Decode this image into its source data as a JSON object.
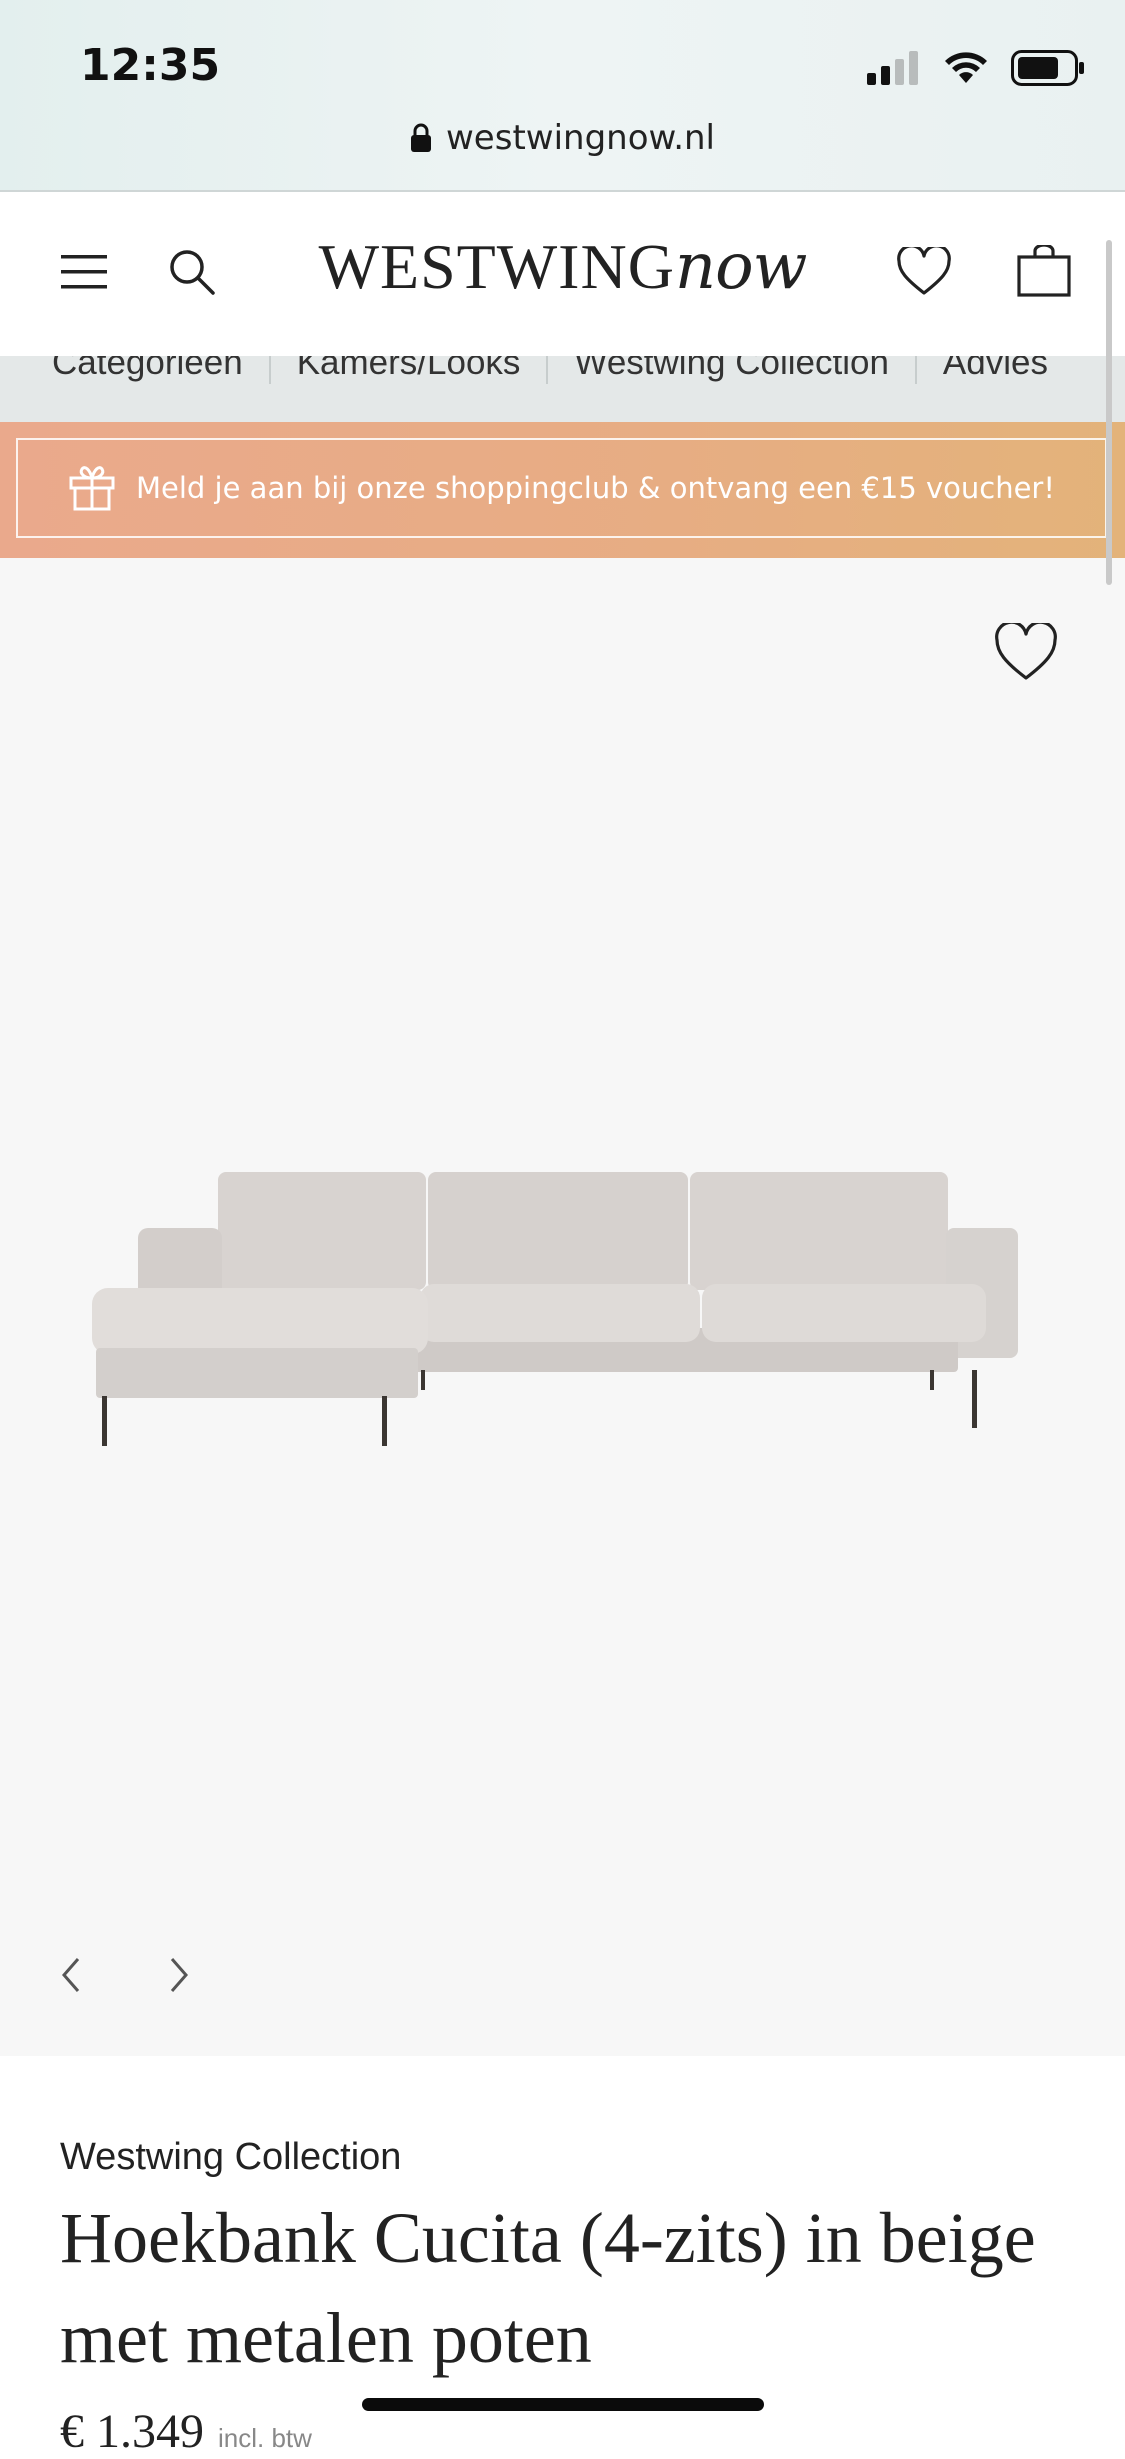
{
  "status_bar": {
    "time": "12:35",
    "url": "westwingnow.nl"
  },
  "header": {
    "logo_main": "WESTWING",
    "logo_now": "now"
  },
  "category_nav": {
    "items": [
      "Categorieen",
      "Kamers/Looks",
      "Westwing Collection",
      "Advies"
    ]
  },
  "banner": {
    "text": "Meld je aan bij onze shoppingclub & ontvang een €15 voucher!"
  },
  "product": {
    "brand": "Westwing Collection",
    "title": "Hoekbank Cucita (4-zits) in beige met metalen poten",
    "price": "€ 1.349",
    "price_note": "incl. btw"
  },
  "colors": {
    "banner": "#e7ad83",
    "nav_bg": "#e4e8e8",
    "gallery_bg": "#f7f7f7",
    "sofa": "#d9d5d2"
  }
}
